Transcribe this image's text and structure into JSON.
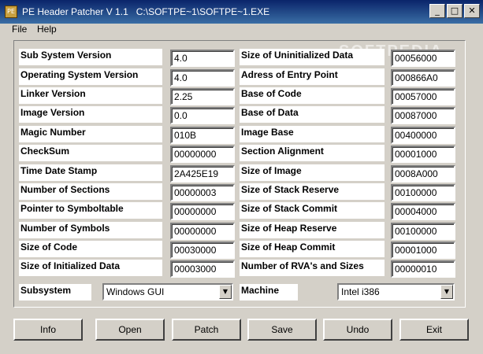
{
  "window": {
    "title": "PE Header Patcher V 1.1   C:\\SOFTPE~1\\SOFTPE~1.EXE",
    "icon": "app-icon",
    "minimize": "_",
    "maximize": "□",
    "close": "✕"
  },
  "menu": {
    "file": "File",
    "help": "Help"
  },
  "watermark": "SOFTPEDIA",
  "left_fields": [
    {
      "label": "Sub System Version",
      "value": "4.0"
    },
    {
      "label": "Operating System Version",
      "value": "4.0"
    },
    {
      "label": "Linker Version",
      "value": "2.25"
    },
    {
      "label": "Image Version",
      "value": "0.0"
    },
    {
      "label": "Magic Number",
      "value": "010B"
    },
    {
      "label": "CheckSum",
      "value": "00000000"
    },
    {
      "label": "Time Date Stamp",
      "value": "2A425E19"
    },
    {
      "label": "Number of Sections",
      "value": "00000003"
    },
    {
      "label": "Pointer to Symboltable",
      "value": "00000000"
    },
    {
      "label": "Number of Symbols",
      "value": "00000000"
    },
    {
      "label": "Size of Code",
      "value": "00030000"
    },
    {
      "label": "Size of Initialized Data",
      "value": "00003000"
    }
  ],
  "right_fields": [
    {
      "label": "Size of Uninitialized Data",
      "value": "00056000"
    },
    {
      "label": "Adress of Entry Point",
      "value": "000866A0"
    },
    {
      "label": "Base of Code",
      "value": "00057000"
    },
    {
      "label": "Base of Data",
      "value": "00087000"
    },
    {
      "label": "Image Base",
      "value": "00400000"
    },
    {
      "label": "Section Alignment",
      "value": "00001000"
    },
    {
      "label": "Size of Image",
      "value": "0008A000"
    },
    {
      "label": "Size of Stack Reserve",
      "value": "00100000"
    },
    {
      "label": "Size of Stack Commit",
      "value": "00004000"
    },
    {
      "label": "Size of Heap Reserve",
      "value": "00100000"
    },
    {
      "label": "Size of Heap Commit",
      "value": "00001000"
    },
    {
      "label": "Number of RVA's and Sizes",
      "value": "00000010"
    }
  ],
  "subsystem": {
    "label": "Subsystem",
    "value": "Windows GUI"
  },
  "machine": {
    "label": "Machine",
    "value": "Intel i386"
  },
  "buttons": {
    "info": "Info",
    "open": "Open",
    "patch": "Patch",
    "save": "Save",
    "undo": "Undo",
    "exit": "Exit"
  }
}
